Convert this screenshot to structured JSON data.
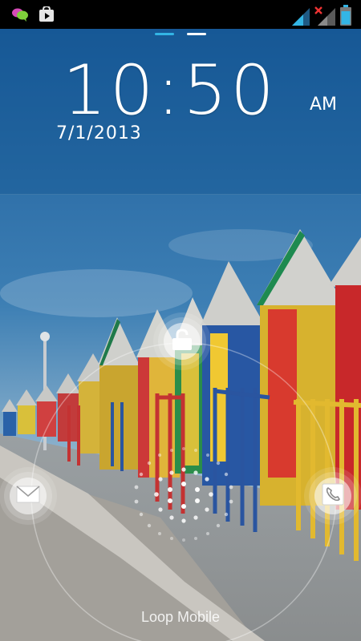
{
  "status_bar": {
    "notification_icons": [
      "chat-bubbles-icon",
      "play-store-icon"
    ],
    "system_icons": [
      "signal-strength-icon",
      "signal-no-data-icon",
      "battery-icon"
    ]
  },
  "lockscreen": {
    "page_count": 2,
    "active_page": 1,
    "clock": {
      "time": "10:50",
      "ampm": "AM"
    },
    "date": "7/1/2013",
    "carrier": "Loop Mobile",
    "targets": [
      {
        "name": "unlock",
        "icon": "unlock-padlock-icon"
      },
      {
        "name": "messaging",
        "icon": "envelope-icon"
      },
      {
        "name": "phone",
        "icon": "phone-handset-icon"
      }
    ]
  },
  "colors": {
    "accent": "#33b5e5",
    "status_bar": "#000000",
    "clock_text": "#ffffff"
  }
}
